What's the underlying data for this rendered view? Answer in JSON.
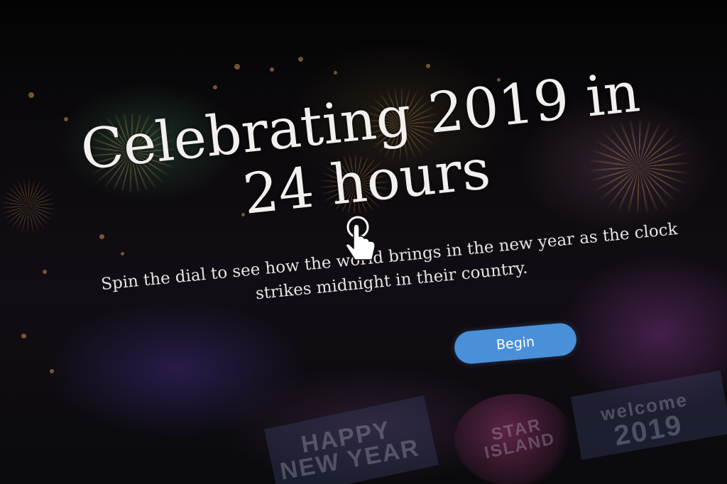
{
  "hero": {
    "headline_line1": "Celebrating 2019 in",
    "headline_line2": "24 hours",
    "subtitle_line1": "Spin the dial to see how the world brings in the new year as the clock",
    "subtitle_line2": "strikes midnight in their country.",
    "begin_label": "Begin"
  },
  "background": {
    "banner_left_line1": "HAPPY",
    "banner_left_line2": "NEW YEAR",
    "banner_right_line1": "welcome",
    "banner_right_line2": "2019",
    "orb_line1": "STAR",
    "orb_line2": "ISLAND"
  },
  "colors": {
    "accent": "#4a90d9",
    "headline": "#f2f0ee",
    "background": "#050306"
  },
  "icons": {
    "cursor": "hand-pointer-icon"
  }
}
